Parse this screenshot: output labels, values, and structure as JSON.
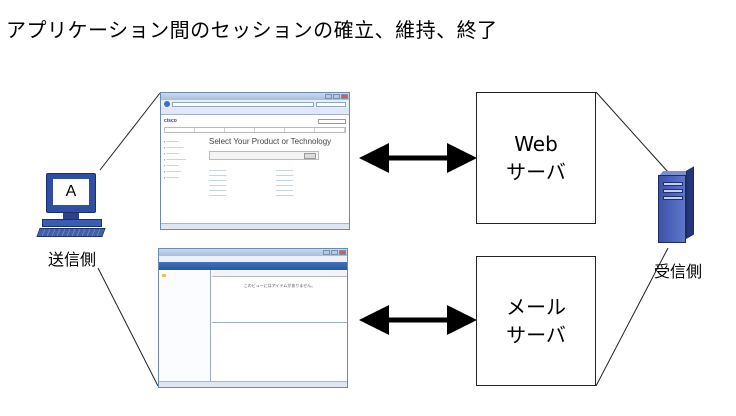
{
  "title": "アプリケーション間のセッションの確立、維持、終了",
  "web_server": {
    "line1": "Web",
    "line2": "サーバ"
  },
  "mail_server": {
    "line1": "メール",
    "line2": "サーバ"
  },
  "sender": {
    "label": "送信側",
    "screen_letter": "A"
  },
  "receiver": {
    "label": "受信側"
  },
  "browser_window": {
    "page_heading": "Select Your Product or Technology",
    "logo": "cisco"
  },
  "mail_window": {
    "message": "このビューにはアイテムがありません。"
  },
  "colors": {
    "line": "#222222",
    "arrow": "#000000",
    "device_blue": "#2f4fa3"
  }
}
